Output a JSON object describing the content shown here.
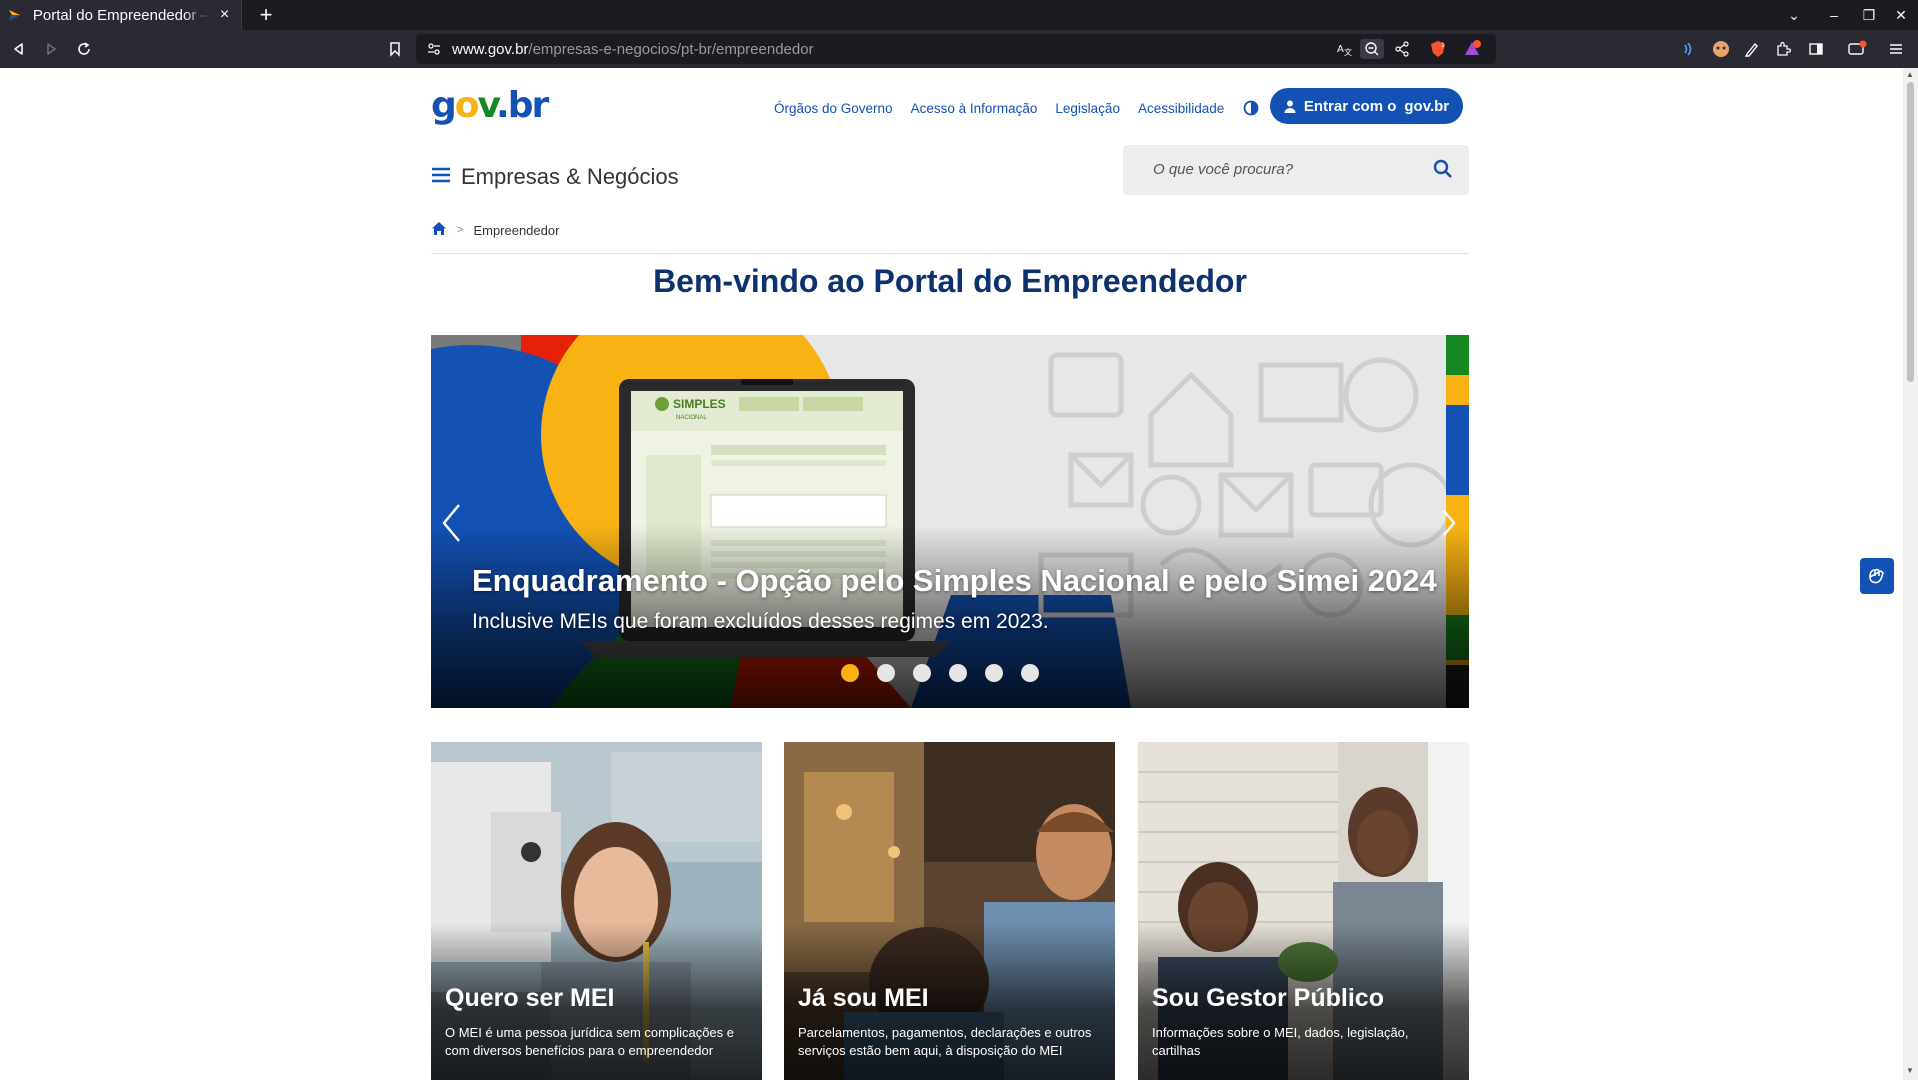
{
  "browser": {
    "tab_title": "Portal do Empreendedor — gov.br",
    "tab_close": "×",
    "new_tab": "+",
    "url_host": "www.gov.br",
    "url_path": "/empresas-e-negocios/pt-br/empreendedor",
    "window_controls": [
      "⌄",
      "–",
      "❐",
      "✕"
    ],
    "shield_badge": "1",
    "alert_badge": "1"
  },
  "header": {
    "logo": {
      "g": "g",
      "o": "o",
      "v": "v",
      "dot": ".",
      "b": "b",
      "r": "r"
    },
    "links": [
      "Órgãos do Governo",
      "Acesso à Informação",
      "Legislação",
      "Acessibilidade"
    ],
    "login_prefix": "Entrar com o",
    "login_brand": "gov.br",
    "menu_title": "Empresas & Negócios",
    "search_placeholder": "O que você procura?"
  },
  "breadcrumb": {
    "separator": ">",
    "current": "Empreendedor"
  },
  "page_title": "Bem-vindo ao Portal do Empreendedor",
  "carousel": {
    "headline": "Enquadramento - Opção pelo Simples Nacional e pelo Simei 2024",
    "subtitle": "Inclusive MEIs que foram excluídos desses regimes em 2023.",
    "screen_brand": "SIMPLES",
    "screen_brand_sub": "NACIONAL",
    "slide_count": 6,
    "active_slide": 1
  },
  "cards": [
    {
      "title": "Quero ser MEI",
      "desc": "O MEI é uma pessoa jurídica sem complicações e com diversos benefícios para o empreendedor"
    },
    {
      "title": "Já sou MEI",
      "desc": "Parcelamentos, pagamentos, declarações e outros serviços estão bem aqui, à disposição do MEI"
    },
    {
      "title": "Sou Gestor Público",
      "desc": "Informações sobre o MEI, dados, legislação, cartilhas"
    }
  ],
  "colors": {
    "brand_blue": "#1351b4",
    "title_blue": "#0c326f",
    "accent_yellow": "#f8b214",
    "green": "#168821"
  }
}
